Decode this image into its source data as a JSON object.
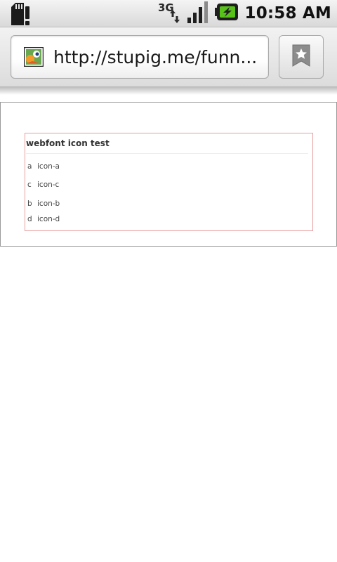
{
  "status_bar": {
    "time": "10:58 AM",
    "network_label": "3G",
    "icons": [
      "sd-card-alert-icon",
      "3g-data-icon",
      "signal-strength-icon",
      "battery-charging-icon"
    ]
  },
  "browser": {
    "url": "http://stupig.me/funn...",
    "favicon": "site-favicon-icon",
    "bookmark_icon": "bookmark-star-icon"
  },
  "page": {
    "title": "webfont icon test",
    "icons": [
      {
        "glyph": "a",
        "name": "icon-a"
      },
      {
        "glyph": "c",
        "name": "icon-c"
      },
      {
        "glyph": "b",
        "name": "icon-b"
      },
      {
        "glyph": "d",
        "name": "icon-d"
      }
    ]
  },
  "colors": {
    "test_box_border": "#e8a0a0",
    "battery_green": "#59c21a"
  }
}
